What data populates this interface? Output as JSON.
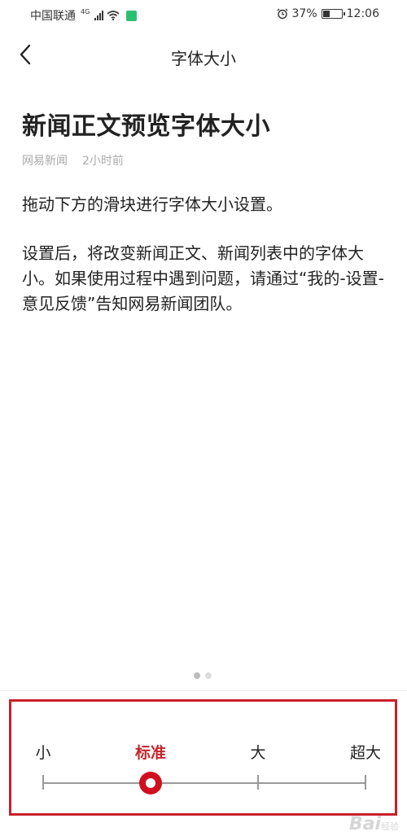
{
  "status_bar": {
    "carrier": "中国联通",
    "network": "4G",
    "battery_percent": "37%",
    "battery_level": 0.37,
    "time": "12:06",
    "icons": [
      "signal-icon",
      "wifi-icon",
      "app-badge-icon",
      "alarm-icon",
      "battery-icon"
    ]
  },
  "header": {
    "back_icon": "chevron-left-icon",
    "title": "字体大小"
  },
  "article": {
    "title": "新闻正文预览字体大小",
    "source": "网易新闻",
    "time_ago": "2小时前",
    "paragraphs": [
      "拖动下方的滑块进行字体大小设置。",
      "设置后，将改变新闻正文、新闻列表中的字体大小。如果使用过程中遇到问题，请通过“我的-设置-意见反馈”告知网易新闻团队。"
    ]
  },
  "pager": {
    "count": 2,
    "active_index": 0
  },
  "font_size_slider": {
    "options": [
      "小",
      "标准",
      "大",
      "超大"
    ],
    "selected_index": 1,
    "accent_color": "#c0272d",
    "highlight_border_color": "#c8202a"
  },
  "watermark": {
    "text": "Bai",
    "suffix": "经验"
  }
}
